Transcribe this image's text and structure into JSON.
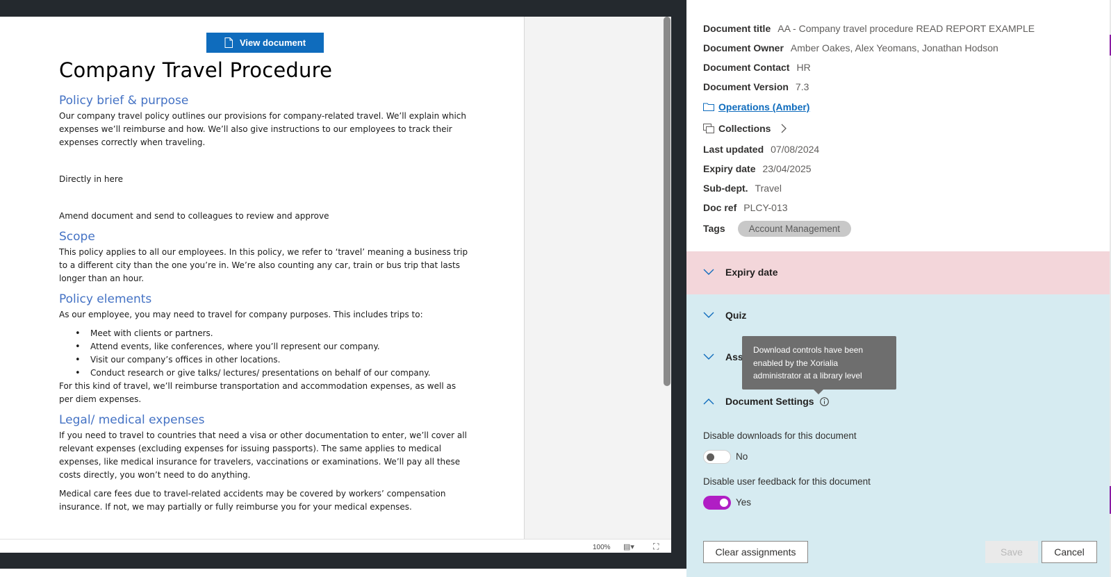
{
  "viewer": {
    "view_document_label": "View document",
    "zoom": "100%"
  },
  "document": {
    "title": "Company Travel Procedure",
    "h_policy": "Policy brief & purpose",
    "p_policy": "Our company travel policy outlines our provisions for company-related travel. We’ll explain which expenses we’ll reimburse and how. We’ll also give instructions to our employees to track their expenses correctly when traveling.",
    "p_directly": "Directly in here",
    "p_amend": "Amend document and send to colleagues to review and approve",
    "h_scope": "Scope",
    "p_scope": "This policy applies to all our employees. In this policy, we refer to ‘travel’ meaning a business trip to a different city than the one you’re in. We’re also counting any car, train or bus trip that lasts longer than an hour.",
    "h_elements": "Policy elements",
    "p_elements": "As our employee, you may need to travel for company purposes. This includes trips to:",
    "bullets": [
      "Meet with clients or partners.",
      "Attend events, like conferences, where you’ll represent our company.",
      "Visit our company’s offices in other locations.",
      "Conduct research or give talks/ lectures/ presentations on behalf of our company."
    ],
    "p_reimburse": "For this kind of travel, we’ll reimburse transportation and accommodation expenses, as well as per diem expenses.",
    "h_legal": "Legal/ medical expenses",
    "p_legal": "If you need to travel to countries that need a visa or other documentation to enter, we’ll cover all relevant expenses (excluding expenses for issuing passports). The same applies to medical expenses, like medical insurance for travelers, vaccinations or examinations. We’ll pay all these costs directly, you won’t need to do anything.",
    "p_medical": "Medical care fees due to travel-related accidents may be covered by workers’ compensation insurance. If not, we may partially or fully reimburse you for your medical expenses."
  },
  "meta": {
    "title_key": "Document title",
    "title_val": "AA - Company travel procedure READ REPORT EXAMPLE",
    "owner_key": "Document Owner",
    "owner_val": "Amber Oakes, Alex Yeomans, Jonathan Hodson",
    "contact_key": "Document Contact",
    "contact_val": "HR",
    "version_key": "Document Version",
    "version_val": "7.3",
    "folder_link": "Operations (Amber)",
    "collections_label": "Collections",
    "updated_key": "Last updated",
    "updated_val": "07/08/2024",
    "expiry_key": "Expiry date",
    "expiry_val": "23/04/2025",
    "subdept_key": "Sub-dept.",
    "subdept_val": "Travel",
    "docref_key": "Doc ref",
    "docref_val": "PLCY-013",
    "tags_key": "Tags",
    "tag_1": "Account Management"
  },
  "sections": {
    "expiry_label": "Expiry date",
    "quiz_label": "Quiz",
    "assign_label": "Assi",
    "settings_label": "Document Settings"
  },
  "tooltip": {
    "text": "Download controls have been enabled by the Xorialia administrator at a library level"
  },
  "settings": {
    "downloads_label": "Disable downloads for this document",
    "downloads_value": "No",
    "feedback_label": "Disable user feedback for this document",
    "feedback_value": "Yes"
  },
  "footer": {
    "clear_label": "Clear assignments",
    "save_label": "Save",
    "cancel_label": "Cancel"
  },
  "colors": {
    "primary": "#0f6cbd",
    "expiry_bg": "#f3d6da",
    "section_bg": "#d6ebf1",
    "toggle_on": "#b01ec4"
  }
}
